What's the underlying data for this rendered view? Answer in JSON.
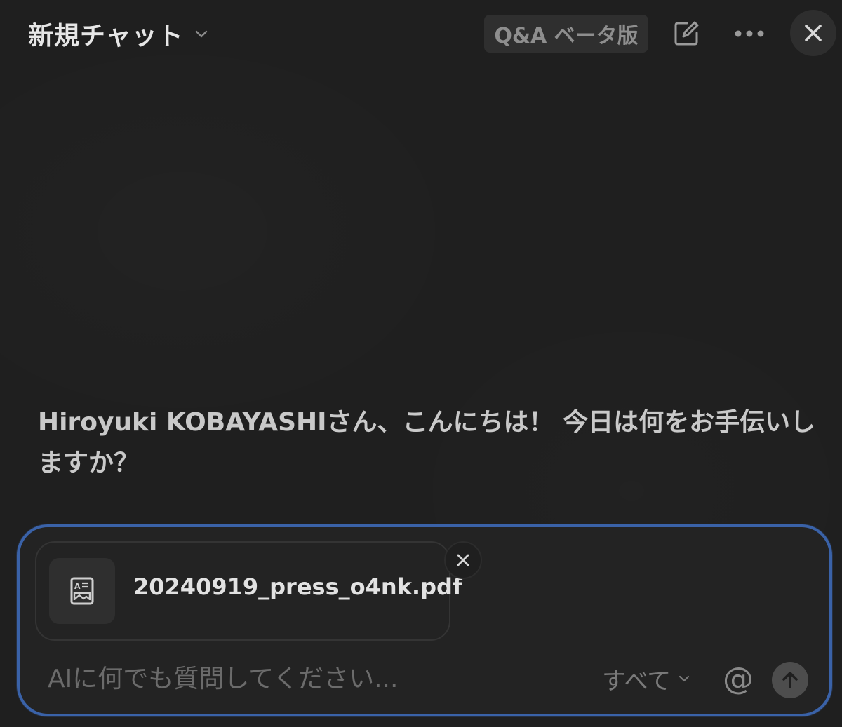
{
  "header": {
    "title": "新規チャット",
    "beta_badge": "Q&A ベータ版",
    "icons": {
      "title_dropdown": "chevron-down-icon",
      "new_chat": "compose-icon",
      "more": "more-horizontal-icon",
      "close": "close-icon"
    }
  },
  "greeting": {
    "text": "Hiroyuki KOBAYASHIさん、こんにちは！ 今日は何をお手伝いしますか？"
  },
  "composer": {
    "attachment": {
      "file_name": "20240919_press_o4nk.pdf",
      "icon": "document-image-icon",
      "remove_icon": "close-icon"
    },
    "input": {
      "value": "",
      "placeholder": "AIに何でも質問してください..."
    },
    "scope": {
      "selected": "すべて",
      "icon": "chevron-down-icon"
    },
    "mention_symbol": "@",
    "send_icon": "arrow-up-icon"
  },
  "colors": {
    "background": "#1f1f1f",
    "composer_border": "#3a62a8",
    "badge_background": "#2f2f2f"
  }
}
